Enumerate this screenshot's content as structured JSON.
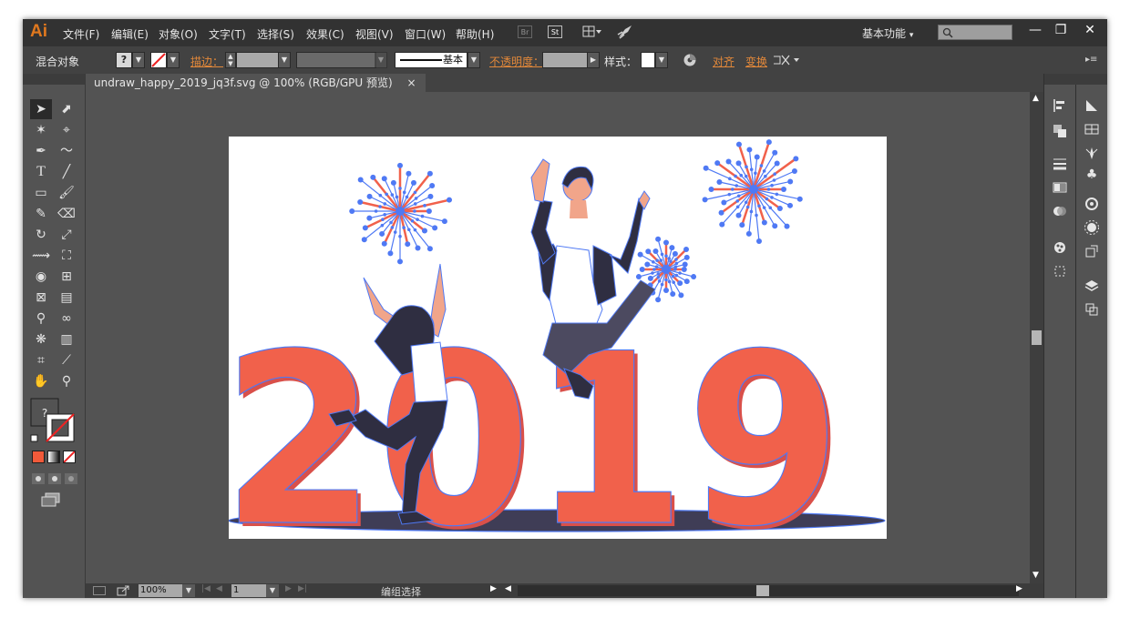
{
  "app": {
    "logo": "Ai"
  },
  "menu": [
    {
      "label": "文件(F)"
    },
    {
      "label": "编辑(E)"
    },
    {
      "label": "对象(O)"
    },
    {
      "label": "文字(T)"
    },
    {
      "label": "选择(S)"
    },
    {
      "label": "效果(C)"
    },
    {
      "label": "视图(V)"
    },
    {
      "label": "窗口(W)"
    },
    {
      "label": "帮助(H)"
    }
  ],
  "top_icons": {
    "bridge": "Br",
    "stock": "St"
  },
  "workspace": {
    "label": "基本功能",
    "arrow": "▾"
  },
  "window_controls": {
    "minimize": "—",
    "restore": "❐",
    "close": "✕"
  },
  "control_bar": {
    "object_type": "混合对象",
    "stroke_link": "描边",
    "stroke_colon": "：",
    "stroke_style": "基本",
    "opacity_link": "不透明度",
    "opacity_colon": "：",
    "style_label": "样式：",
    "align_link": "对齐",
    "transform_link": "变换",
    "fill_question": "?"
  },
  "document": {
    "tab_title": "undraw_happy_2019_jq3f.svg @ 100% (RGB/GPU 预览)",
    "close": "×"
  },
  "artwork": {
    "year_text": "2019"
  },
  "status": {
    "zoom": "100%",
    "artboard_number": "1",
    "selection_status": "编组选择"
  },
  "tools": {
    "select": "➤",
    "direct_select": "⬈",
    "magic_wand": "✶",
    "lasso": "⌖",
    "pen": "✒",
    "curvature": "〜",
    "type": "T",
    "line": "╱",
    "rect": "▭",
    "paintbrush": "🖌",
    "pencil": "✎",
    "eraser": "⌫",
    "rotate": "↻",
    "scale": "⤢",
    "width": "⟿",
    "free_transform": "⛶",
    "shape_builder": "◉",
    "perspective": "⊞",
    "mesh": "⊠",
    "gradient": "▤",
    "eyedropper": "⚲",
    "blend": "∞",
    "symbol_sprayer": "❋",
    "column_graph": "▥",
    "artboard": "⌗",
    "slice": "⟋",
    "hand": "✋",
    "zoom": "⚲"
  },
  "colors": {
    "ai_orange": "#e0781e",
    "link_orange": "#e2883a",
    "numeral_red": "#f1614b",
    "numeral_shadow": "#d9504a",
    "figure_navy": "#2f2e41",
    "selection_blue": "#4f79f4",
    "ui_dark": "#323232",
    "ui_mid": "#535353"
  }
}
